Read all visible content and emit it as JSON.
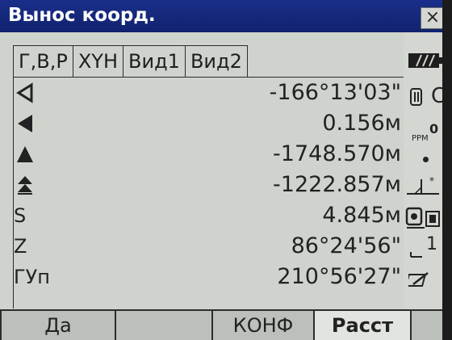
{
  "window": {
    "title": "Вынос коорд.",
    "close_label": "×"
  },
  "tabs": [
    {
      "label": "Г,В,Р",
      "active": true
    },
    {
      "label": "XYH",
      "active": false
    },
    {
      "label": "Вид1",
      "active": false
    },
    {
      "label": "Вид2",
      "active": false
    }
  ],
  "rows": [
    {
      "icon": "triangle-left-outline-icon",
      "label": "",
      "value": "-166°13'03\""
    },
    {
      "icon": "triangle-left-filled-icon",
      "label": "",
      "value": "0.156м"
    },
    {
      "icon": "triangle-up-filled-icon",
      "label": "",
      "value": "-1748.570м"
    },
    {
      "icon": "double-triangle-up-icon",
      "label": "",
      "value": "-1222.857м"
    },
    {
      "icon": "",
      "label": "S",
      "value": "4.845м"
    },
    {
      "icon": "",
      "label": "Z",
      "value": "86°24'56\""
    },
    {
      "icon": "",
      "label": "ГУп",
      "value": "210°56'27\""
    }
  ],
  "status": {
    "c_char": "С",
    "ppm_label": "PPM",
    "ppm_value": "0",
    "index_value": "1",
    "items": [
      "battery-icon",
      "prism-constant-icon",
      "ppm-indicator",
      "dot-indicator",
      "tilt-compensation-icon",
      "target-prism-icon",
      "face-indicator",
      "input-mode-icon"
    ]
  },
  "softkeys": [
    {
      "label": "Да",
      "active": false
    },
    {
      "label": "",
      "active": false
    },
    {
      "label": "КОНФ",
      "active": false
    },
    {
      "label": "Расст",
      "active": true
    },
    {
      "label": "",
      "active": false
    }
  ],
  "colors": {
    "titlebar": "#1a2f8a",
    "background": "#cfd3cd",
    "softkey_bar": "#2c2c2c"
  }
}
